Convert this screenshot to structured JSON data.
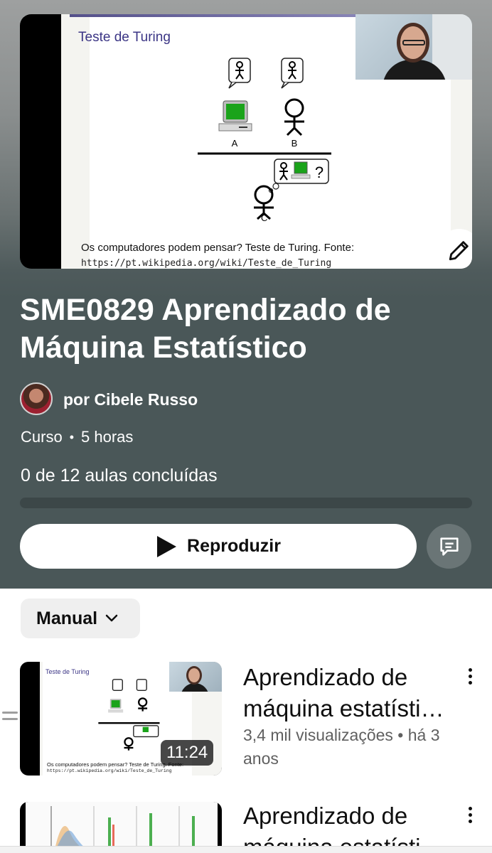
{
  "hero": {
    "slide_title": "Teste de Turing",
    "slide_caption": "Os computadores podem pensar? Teste de Turing. Fonte:",
    "slide_link": "https://pt.wikipedia.org/wiki/Teste_de_Turing",
    "diagram_labels": {
      "a": "A",
      "b": "B",
      "c": "C",
      "question": "?"
    },
    "edit_icon": "pencil-icon"
  },
  "course": {
    "title": "SME0829 Aprendizado de Máquina Estatístico",
    "author": "por Cibele Russo",
    "type": "Curso",
    "separator": "•",
    "duration": "5 horas",
    "progress_text": "0 de 12 aulas concluídas",
    "progress_fraction": 0.0
  },
  "actions": {
    "play_label": "Reproduzir",
    "play_icon": "play-icon",
    "comments_icon": "comment-icon"
  },
  "sort": {
    "label": "Manual",
    "icon": "chevron-down-icon"
  },
  "videos": [
    {
      "title": "Aprendizado de máquina estatísti…",
      "title_line1": "Aprendizado de",
      "title_line2": "máquina estatísti…",
      "meta": "3,4 mil visualizações • há 3 anos",
      "duration": "11:24",
      "thumb_title": "Teste de Turing",
      "thumb_caption": "Os computadores podem pensar? Teste de Turing. Fonte:",
      "thumb_link": "https://pt.wikipedia.org/wiki/Teste_de_Turing"
    },
    {
      "title_line1": "Aprendizado de",
      "title_line2": "máquina estatísti…"
    }
  ],
  "colors": {
    "header_bg": "#4a5758",
    "accent": "#ffffff",
    "slide_title": "#3b3585",
    "computer_green": "#1aa31a"
  }
}
